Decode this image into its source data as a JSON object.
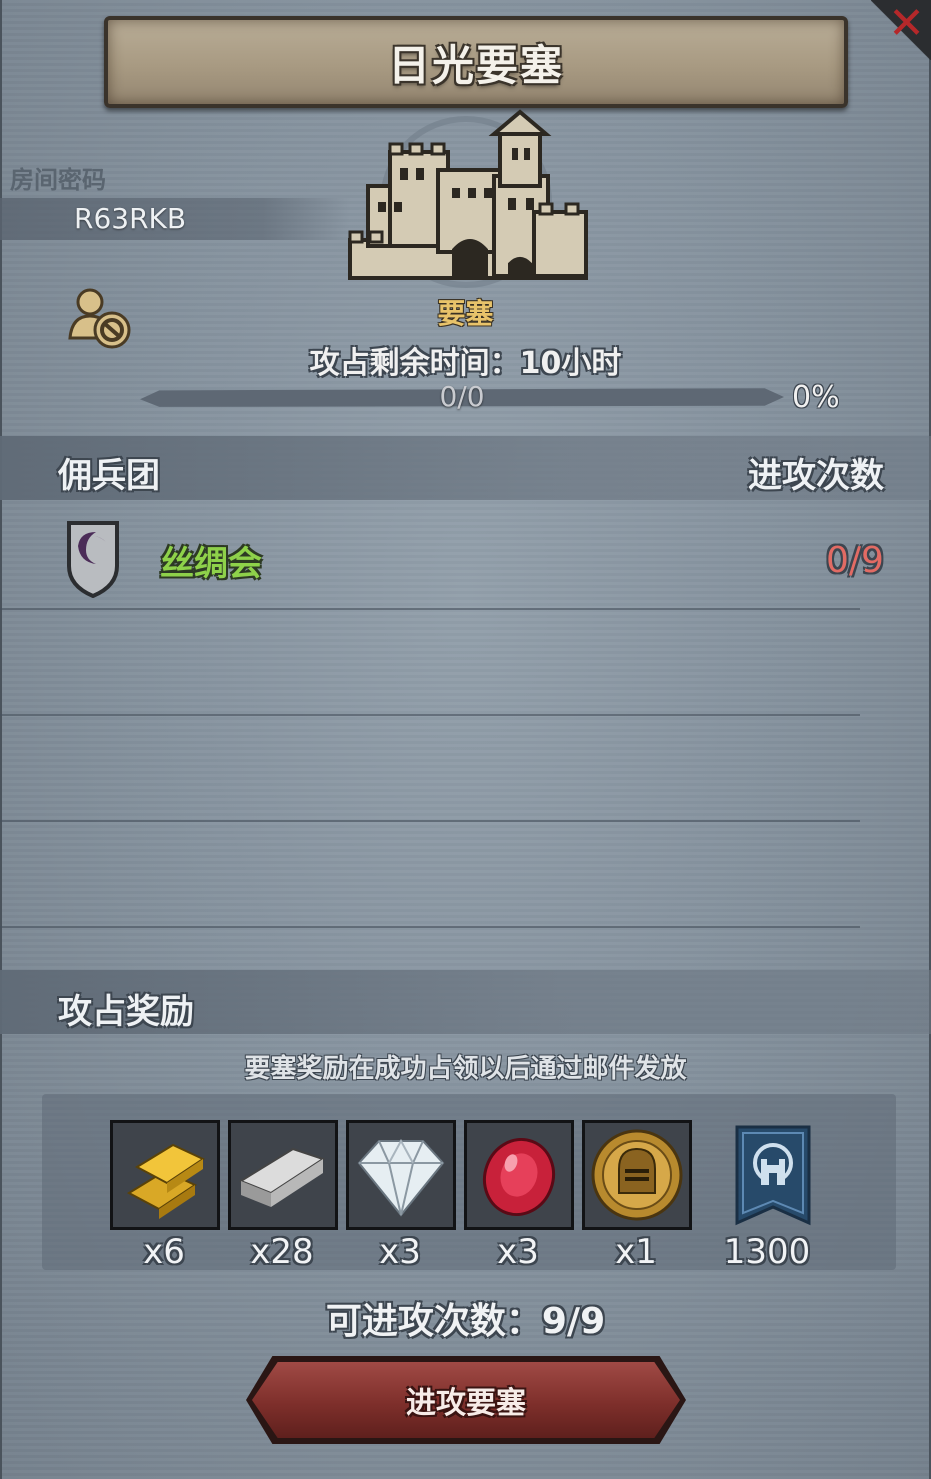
{
  "window": {
    "title": "日光要塞",
    "close_icon": "close-x-icon"
  },
  "room": {
    "label": "房间密码",
    "code": "R63RKB",
    "privacy_icon": "private-room-icon"
  },
  "fortress": {
    "type": "要塞",
    "time_remaining": "攻占剩余时间：10小时",
    "progress": {
      "count_text": "0/0",
      "percent_text": "0%",
      "fraction": 0
    }
  },
  "mercenaries": {
    "header": "佣兵团",
    "column_attacks": "进攻次数",
    "rows": [
      {
        "name": "丝绸会",
        "attacks": "0/9",
        "emblem_icon": "crescent-shield-icon"
      }
    ]
  },
  "rewards": {
    "header": "攻占奖励",
    "note": "要塞奖励在成功占领以后通过邮件发放",
    "items": [
      {
        "icon": "gold-bars-icon",
        "qty": "x6"
      },
      {
        "icon": "silver-ingot-icon",
        "qty": "x28"
      },
      {
        "icon": "diamond-icon",
        "qty": "x3"
      },
      {
        "icon": "ruby-icon",
        "qty": "x3"
      },
      {
        "icon": "knight-coin-icon",
        "qty": "x1"
      },
      {
        "icon": "fortress-banner-icon",
        "qty": "1300"
      }
    ]
  },
  "attack": {
    "count_text": "可进攻次数：9/9",
    "button_label": "进攻要塞"
  },
  "colors": {
    "guild_name": "#8ed14a",
    "attacks_red": "#e26b64",
    "fortress_type": "#e8c36a",
    "button": "#7e2f2b"
  }
}
